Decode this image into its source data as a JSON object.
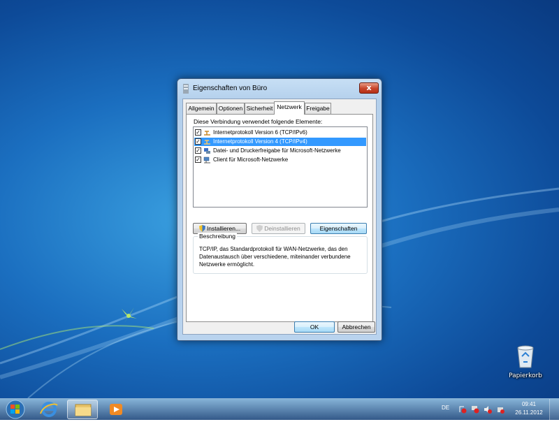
{
  "window": {
    "title": "Eigenschaften von Büro",
    "close_label": "x",
    "tabs": [
      {
        "label": "Allgemein",
        "active": false
      },
      {
        "label": "Optionen",
        "active": false
      },
      {
        "label": "Sicherheit",
        "active": false
      },
      {
        "label": "Netzwerk",
        "active": true
      },
      {
        "label": "Freigabe",
        "active": false
      }
    ],
    "uses_label": "Diese Verbindung verwendet folgende Elemente:",
    "items": [
      {
        "label": "Internetprotokoll Version 6 (TCP/IPv6)",
        "checked": true,
        "selected": false,
        "icon": "network-protocol-icon"
      },
      {
        "label": "Internetprotokoll Version 4 (TCP/IPv4)",
        "checked": true,
        "selected": true,
        "icon": "network-protocol-icon"
      },
      {
        "label": "Datei- und Druckerfreigabe für Microsoft-Netzwerke",
        "checked": true,
        "selected": false,
        "icon": "file-printer-sharing-icon"
      },
      {
        "label": "Client für Microsoft-Netzwerke",
        "checked": true,
        "selected": false,
        "icon": "network-client-icon"
      }
    ],
    "buttons": {
      "install": "Installieren...",
      "uninstall": "Deinstallieren",
      "properties": "Eigenschaften",
      "ok": "OK",
      "cancel": "Abbrechen"
    },
    "description": {
      "legend": "Beschreibung",
      "text": "TCP/IP, das Standardprotokoll für WAN-Netzwerke, das den Datenaustausch über verschiedene, miteinander verbundene Netzwerke ermöglicht."
    }
  },
  "desktop": {
    "recycle_bin_label": "Papierkorb"
  },
  "taskbar": {
    "language": "DE",
    "time": "09:41",
    "date": "26.11.2012"
  },
  "colors": {
    "selection": "#3399ff",
    "desktop_blue": "#1b6fc0",
    "close_red": "#c7442a"
  }
}
